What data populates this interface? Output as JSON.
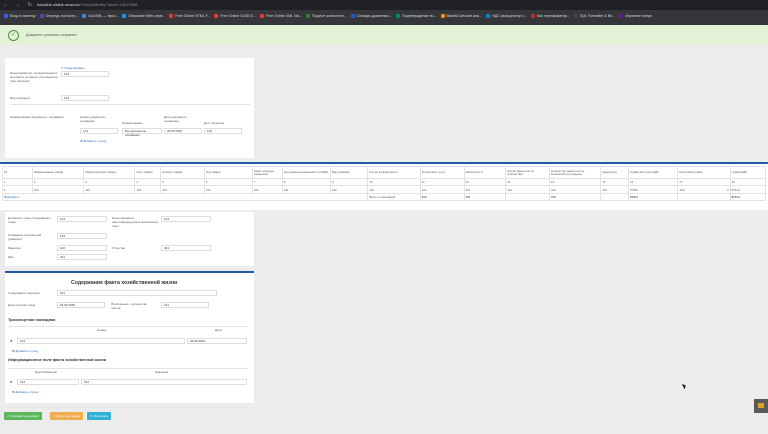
{
  "browser": {
    "nav": "←  →  ↻",
    "url_host": "ddoclink.cislink.moscow",
    "url_path": "/Torkog/Modify?docid=10622988"
  },
  "bookmarks": [
    {
      "label": "Вход в систему",
      "color": "#3d5afe"
    },
    {
      "label": "Очередь на постр...",
      "color": "#673ab7"
    },
    {
      "label": "DocXML — прос...",
      "color": "#3b82f6"
    },
    {
      "label": "Описание Web-серв...",
      "color": "#2196f3"
    },
    {
      "label": "Free Online HTML F...",
      "color": "#e53935"
    },
    {
      "label": "Free Online GUID G...",
      "color": "#e53935"
    },
    {
      "label": "Free Online XML Val...",
      "color": "#e53935"
    },
    {
      "label": "Подсчет количеств...",
      "color": "#2e7d32"
    },
    {
      "label": "Словарь доменных...",
      "color": "#1565c0"
    },
    {
      "label": "Подтверждение по...",
      "color": "#00897b"
    },
    {
      "label": "Base64 Decode and...",
      "color": "#fb8c00"
    },
    {
      "label": "НДС калькулятор с...",
      "color": "#0288d1"
    },
    {
      "label": "Как перефоматир...",
      "color": "#c62828"
    },
    {
      "label": "SQL Formatter & Be...",
      "color": "#37474f"
    },
    {
      "label": "Изучение опера",
      "color": "#6a1b9a"
    }
  ],
  "alert": {
    "text": "Документ успешно сохранен"
  },
  "top_form": {
    "edit_link": "Редактировать",
    "identifier_label": "Идентификатор государственного контракта, договора (соглашения)(при наличии)",
    "identifier_value": "123",
    "operation_label": "Вид операции",
    "operation_value": "123",
    "doc_name_label": "Наименование документа - основания",
    "col_number": "Номер документа - основания",
    "col_name": "Наименование",
    "col_date": "Дата документа - основания",
    "col_extra": "Доп. сведения",
    "row": {
      "number": "123",
      "name": "Без документа-основания",
      "date": "26.05.2025",
      "extra": "123"
    },
    "add_row": "Добавить строку"
  },
  "goods_table": {
    "headers": [
      "№",
      "Наименование товара",
      "Характеристика товара",
      "Сорт товара",
      "Артикул товара",
      "Код товара",
      "Наим. единицы измерения",
      "Код единицы измерения по ОКЕИ",
      "Вид упаковки",
      "Кол-во в одном месте",
      "Кол-во мест, штук",
      "Масса брутто",
      "Кол-во (масса нетто/ количество)",
      "Количество (масса нетто/ количество) (отпущено)",
      "Цена за ед.",
      "Сумма без учета НДС",
      "Налоговая ставка",
      "Сумма НДС"
    ],
    "numbers": [
      "1",
      "2",
      "3",
      "4",
      "5",
      "6",
      "7",
      "8",
      "9",
      "10",
      "11",
      "12",
      "13",
      "14",
      "15",
      "16",
      "17",
      "18"
    ],
    "row": [
      "1",
      "123",
      "123",
      "123",
      "123",
      "312",
      "321",
      "321",
      "312",
      "312",
      "312",
      "312",
      "312",
      "312",
      "312",
      "87344",
      "10%",
      "8734.4"
    ],
    "add_link": "Добавить",
    "total_label": "Всего по накладной",
    "totals": [
      "312",
      "312",
      "-",
      "312",
      "-",
      "87344",
      "",
      "8734.4"
    ]
  },
  "person_form": {
    "position_label": "Должность лица, передавшего товар",
    "position_value": "123",
    "basis_label": "Основание полномочий (доверия)",
    "basis_value": "123",
    "surname_label": "Фамилия",
    "surname_value": "132",
    "name_label": "Имя",
    "name_value": "321",
    "other_info_label": "Иные сведения, идентифицирующие физическое лицо",
    "other_info_value": "123",
    "patronymic_label": "Отчество",
    "patronymic_value": "321"
  },
  "fact_section": {
    "title": "Содержание факта хозяйственной жизни",
    "content_label": "Содержание операции",
    "content_value": "321",
    "date_label": "Дата отгрузки груза",
    "date_value": "26.05.2025",
    "appendix_label": "Приложения - количество листов",
    "appendix_value": "231",
    "waybill_title": "Транспортная накладная",
    "waybill_col_number": "Номер",
    "waybill_col_date": "Дата",
    "waybill_row_number": "123",
    "waybill_row_date": "26.05.2025",
    "waybill_add": "Добавить строку",
    "info_title": "Информационное поле факта хозяйственной жизни",
    "info_col_id": "Идентификатор",
    "info_col_value": "Значение",
    "info_row_id": "123",
    "info_row_value": "312",
    "info_add": "Добавить строку"
  },
  "buttons": {
    "save": "Сохранить документ",
    "back": "Вернуться назад",
    "sign": "Подписать"
  },
  "colors": {
    "save": "#5cb85c",
    "back": "#f0ad4e",
    "sign": "#31b0d5",
    "accent": "#1e5ca8"
  }
}
